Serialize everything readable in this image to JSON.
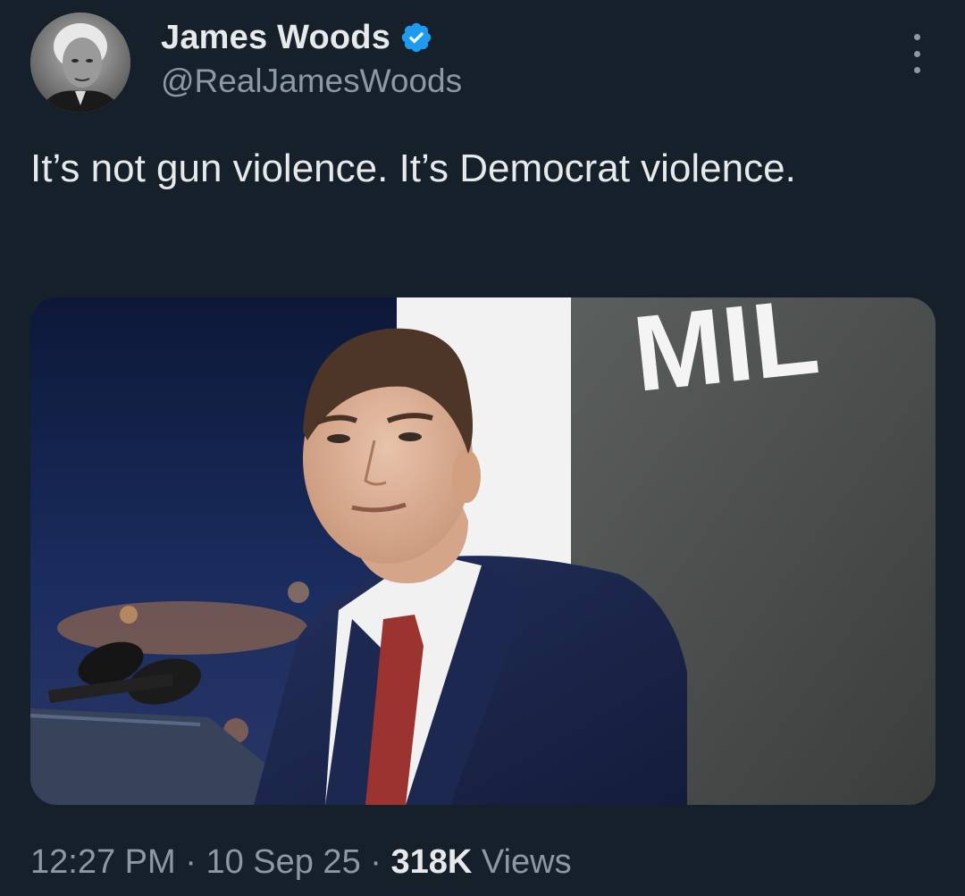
{
  "author": {
    "display_name": "James Woods",
    "handle": "@RealJamesWoods",
    "verified": true
  },
  "tweet": {
    "text": "It’s not gun violence. It’s Democrat violence."
  },
  "media": {
    "background_sign_text": "MIL"
  },
  "meta": {
    "time": "12:27 PM",
    "separator_1": " · ",
    "date": "10 Sep 25",
    "separator_2": " · ",
    "views_count": "318K",
    "views_label": " Views"
  },
  "colors": {
    "background": "#15202b",
    "primary_text": "#e7e9ea",
    "secondary_text": "#8b98a5",
    "verified_blue": "#1d9bf0"
  },
  "icons": {
    "verified": "verified-badge-icon",
    "more": "more-options-icon"
  }
}
